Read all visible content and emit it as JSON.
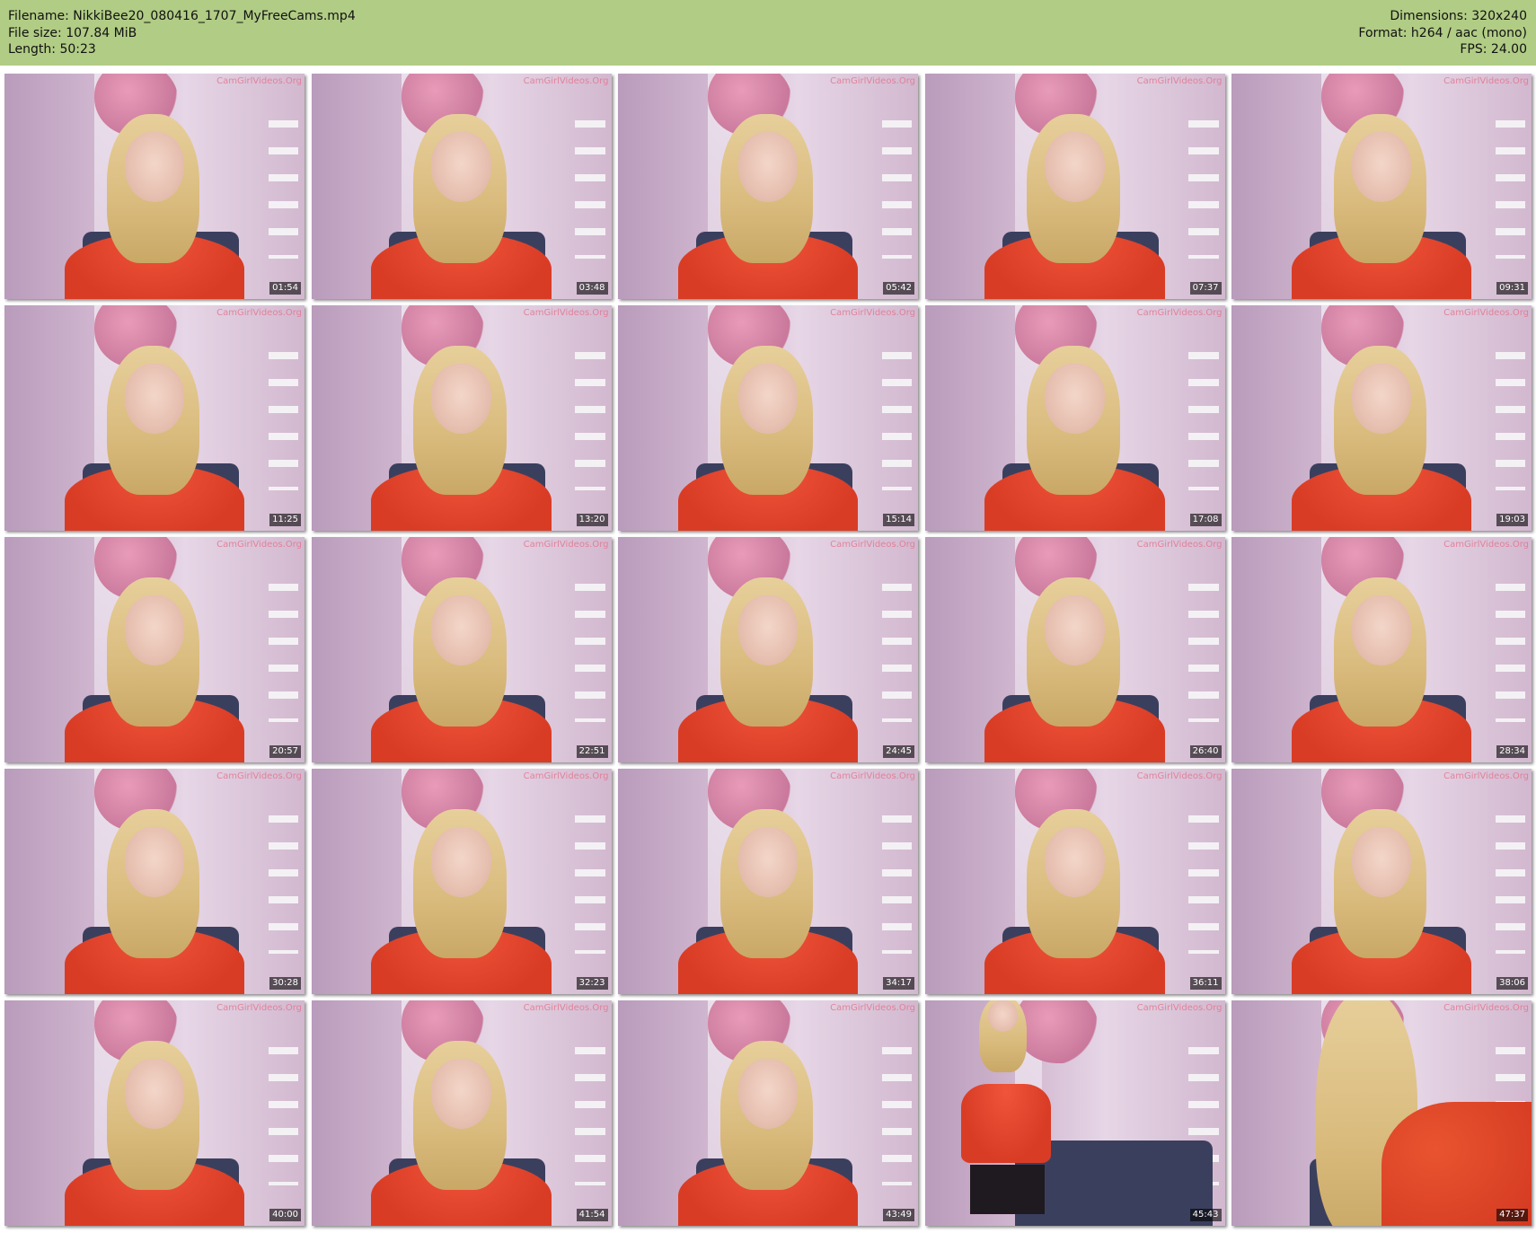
{
  "header": {
    "left": [
      "Filename: NikkiBee20_080416_1707_MyFreeCams.mp4",
      "File size: 107.84 MiB",
      "Length: 50:23"
    ],
    "right": [
      "Dimensions: 320x240",
      "Format: h264 / aac (mono)",
      "FPS: 24.00"
    ],
    "background_color": "#b1cc85"
  },
  "watermark_text": "CamGirlVideos.Org",
  "thumbnails": [
    {
      "time": "01:54"
    },
    {
      "time": "03:48"
    },
    {
      "time": "05:42"
    },
    {
      "time": "07:37"
    },
    {
      "time": "09:31"
    },
    {
      "time": "11:25"
    },
    {
      "time": "13:20"
    },
    {
      "time": "15:14"
    },
    {
      "time": "17:08"
    },
    {
      "time": "19:03"
    },
    {
      "time": "20:57"
    },
    {
      "time": "22:51"
    },
    {
      "time": "24:45"
    },
    {
      "time": "26:40"
    },
    {
      "time": "28:34"
    },
    {
      "time": "30:28"
    },
    {
      "time": "32:23"
    },
    {
      "time": "34:17"
    },
    {
      "time": "36:11"
    },
    {
      "time": "38:06"
    },
    {
      "time": "40:00"
    },
    {
      "time": "41:54"
    },
    {
      "time": "43:49"
    },
    {
      "time": "45:43"
    },
    {
      "time": "47:37"
    }
  ]
}
